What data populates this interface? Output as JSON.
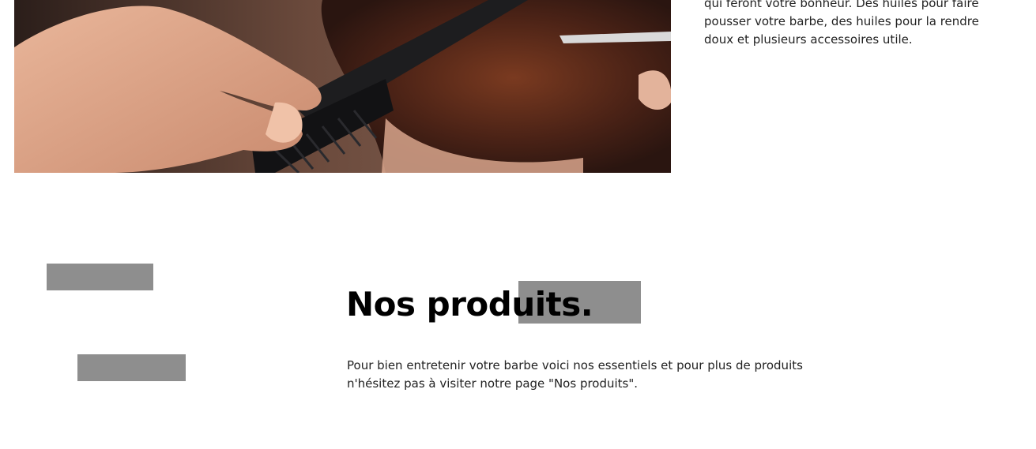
{
  "hero": {
    "image_alt_icon": "barber-comb-photo"
  },
  "intro": {
    "text": "qui feront votre bonheur. Des huiles pour faire pousser votre barbe, des huiles pour la rendre doux et plusieurs accessoires utile."
  },
  "products": {
    "title": "Nos produits.",
    "description": "Pour bien entretenir votre barbe voici nos essentiels et pour plus de produits n'hésitez pas à visiter notre page \"Nos produits\"."
  },
  "colors": {
    "placeholder": "#8e8e8e",
    "title": "#000000",
    "text": "#222222",
    "background": "#ffffff"
  }
}
